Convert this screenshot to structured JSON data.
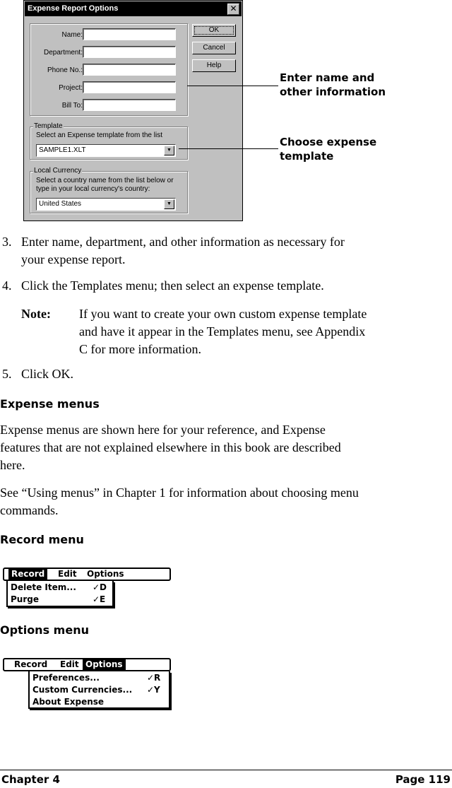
{
  "dialog": {
    "title": "Expense Report Options",
    "close_icon": "close-x-icon",
    "close_glyph": "✕",
    "fields": [
      {
        "label": "Name:",
        "value": ""
      },
      {
        "label": "Department:",
        "value": ""
      },
      {
        "label": "Phone No.:",
        "value": ""
      },
      {
        "label": "Project:",
        "value": ""
      },
      {
        "label": "Bill To:",
        "value": ""
      }
    ],
    "buttons": {
      "ok": "OK",
      "cancel": "Cancel",
      "help": "Help"
    },
    "template_group": {
      "legend": "Template",
      "hint": "Select an Expense template from the list",
      "selected": "SAMPLE1.XLT"
    },
    "currency_group": {
      "legend": "Local Currency",
      "hint_line1": "Select a country name from the list below or",
      "hint_line2": "type in your local currency's country:",
      "selected": "United States"
    },
    "dropdown_arrow_glyph": "▼"
  },
  "callouts": {
    "enter_name_line1": "Enter name and",
    "enter_name_line2": "other information",
    "choose_template_line1": "Choose expense",
    "choose_template_line2": "template"
  },
  "steps": [
    {
      "num": "3.",
      "line1": "Enter name, department, and other information as necessary for",
      "line2": "your expense report."
    },
    {
      "num": "4.",
      "line1": "Click the Templates menu; then select an expense template."
    },
    {
      "num": "5.",
      "line1": "Click OK."
    }
  ],
  "note": {
    "label": "Note:",
    "line1": "If you want to create your own custom expense template",
    "line2": "and have it appear in the Templates menu, see Appendix",
    "line3": "C for more information."
  },
  "section": {
    "heading": "Expense menus",
    "para1_line1": "Expense menus are shown here for your reference, and Expense",
    "para1_line2": "features that are not explained elsewhere in this book are described",
    "para1_line3": "here.",
    "para2_line1": "See “Using menus” in Chapter 1 for information about choosing menu",
    "para2_line2": "commands."
  },
  "record_menu": {
    "heading": "Record menu",
    "bar": [
      "Record",
      "Edit",
      "Options"
    ],
    "active": "Record",
    "items": [
      {
        "label": "Delete Item...",
        "shortcut": "✓D"
      },
      {
        "label": "Purge",
        "shortcut": "✓E"
      }
    ]
  },
  "options_menu": {
    "heading": "Options menu",
    "bar": [
      "Record",
      "Edit",
      "Options"
    ],
    "active": "Options",
    "items": [
      {
        "label": "Preferences...",
        "shortcut": "✓R"
      },
      {
        "label": "Custom Currencies...",
        "shortcut": "✓Y"
      },
      {
        "label": "About Expense",
        "shortcut": ""
      }
    ]
  },
  "footer": {
    "chapter": "Chapter 4",
    "page": "Page 119"
  }
}
